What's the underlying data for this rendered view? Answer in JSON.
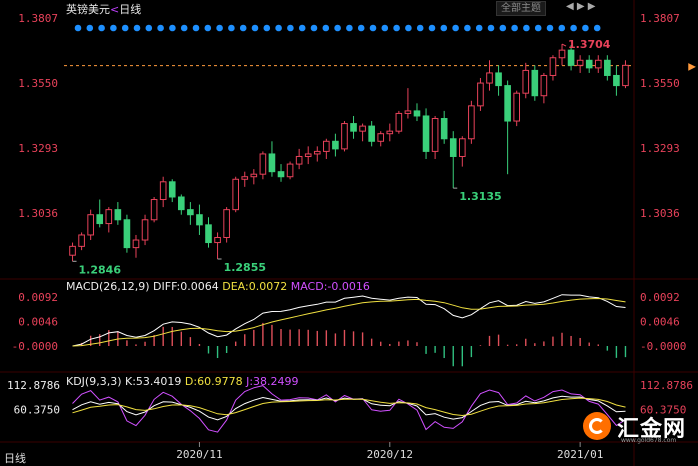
{
  "title": {
    "pair": "英镑美元",
    "sep": "<",
    "period": "日线"
  },
  "toolbar": {
    "theme_label": "全部主题",
    "nav": "◀ ▶ ▶"
  },
  "period_tab": "日线",
  "chart_data": [
    {
      "type": "candlestick",
      "title": "英镑美元 日线",
      "y_ticks": [
        "1.3807",
        "1.3550",
        "1.3293",
        "1.3036"
      ],
      "ylim": [
        1.278,
        1.3807
      ],
      "x_tick_labels": [
        "2020/11",
        "2020/12",
        "2021/01"
      ],
      "current_price_line": 1.3619,
      "annotations": [
        {
          "text": "1.2846",
          "value": 1.2846
        },
        {
          "text": "1.2855",
          "value": 1.2855
        },
        {
          "text": "1.3135",
          "value": 1.3135
        },
        {
          "text": "1.3704",
          "value": 1.3704
        }
      ],
      "series": [
        {
          "name": "price",
          "ohlc": [
            [
              1.287,
              1.292,
              1.2846,
              1.2905
            ],
            [
              1.2905,
              1.296,
              1.289,
              1.295
            ],
            [
              1.295,
              1.305,
              1.293,
              1.303
            ],
            [
              1.303,
              1.309,
              1.298,
              1.2995
            ],
            [
              1.2995,
              1.306,
              1.296,
              1.305
            ],
            [
              1.305,
              1.308,
              1.299,
              1.301
            ],
            [
              1.301,
              1.303,
              1.288,
              1.29
            ],
            [
              1.29,
              1.295,
              1.286,
              1.293
            ],
            [
              1.293,
              1.303,
              1.291,
              1.301
            ],
            [
              1.301,
              1.31,
              1.3,
              1.309
            ],
            [
              1.309,
              1.318,
              1.306,
              1.316
            ],
            [
              1.316,
              1.317,
              1.308,
              1.31
            ],
            [
              1.31,
              1.311,
              1.303,
              1.305
            ],
            [
              1.305,
              1.308,
              1.299,
              1.303
            ],
            [
              1.303,
              1.307,
              1.295,
              1.299
            ],
            [
              1.299,
              1.302,
              1.29,
              1.292
            ],
            [
              1.292,
              1.296,
              1.2855,
              1.294
            ],
            [
              1.294,
              1.306,
              1.292,
              1.305
            ],
            [
              1.305,
              1.318,
              1.304,
              1.317
            ],
            [
              1.317,
              1.32,
              1.314,
              1.318
            ],
            [
              1.318,
              1.321,
              1.315,
              1.319
            ],
            [
              1.319,
              1.328,
              1.317,
              1.327
            ],
            [
              1.327,
              1.332,
              1.318,
              1.32
            ],
            [
              1.32,
              1.323,
              1.316,
              1.318
            ],
            [
              1.318,
              1.324,
              1.317,
              1.323
            ],
            [
              1.323,
              1.329,
              1.321,
              1.326
            ],
            [
              1.326,
              1.33,
              1.323,
              1.327
            ],
            [
              1.327,
              1.33,
              1.324,
              1.328
            ],
            [
              1.328,
              1.333,
              1.325,
              1.332
            ],
            [
              1.332,
              1.335,
              1.326,
              1.329
            ],
            [
              1.329,
              1.34,
              1.328,
              1.339
            ],
            [
              1.339,
              1.342,
              1.333,
              1.336
            ],
            [
              1.336,
              1.339,
              1.332,
              1.338
            ],
            [
              1.338,
              1.34,
              1.33,
              1.332
            ],
            [
              1.332,
              1.336,
              1.33,
              1.335
            ],
            [
              1.335,
              1.339,
              1.332,
              1.336
            ],
            [
              1.336,
              1.344,
              1.335,
              1.343
            ],
            [
              1.343,
              1.353,
              1.341,
              1.344
            ],
            [
              1.344,
              1.347,
              1.34,
              1.342
            ],
            [
              1.342,
              1.345,
              1.325,
              1.328
            ],
            [
              1.328,
              1.342,
              1.325,
              1.341
            ],
            [
              1.341,
              1.344,
              1.331,
              1.333
            ],
            [
              1.333,
              1.336,
              1.3135,
              1.326
            ],
            [
              1.326,
              1.334,
              1.322,
              1.333
            ],
            [
              1.333,
              1.348,
              1.331,
              1.346
            ],
            [
              1.346,
              1.357,
              1.344,
              1.355
            ],
            [
              1.355,
              1.364,
              1.352,
              1.359
            ],
            [
              1.359,
              1.362,
              1.35,
              1.354
            ],
            [
              1.354,
              1.356,
              1.319,
              1.34
            ],
            [
              1.34,
              1.352,
              1.338,
              1.351
            ],
            [
              1.351,
              1.363,
              1.349,
              1.36
            ],
            [
              1.36,
              1.362,
              1.348,
              1.35
            ],
            [
              1.35,
              1.359,
              1.347,
              1.358
            ],
            [
              1.358,
              1.366,
              1.356,
              1.365
            ],
            [
              1.365,
              1.3704,
              1.362,
              1.368
            ],
            [
              1.368,
              1.37,
              1.36,
              1.362
            ],
            [
              1.362,
              1.366,
              1.359,
              1.364
            ],
            [
              1.364,
              1.366,
              1.359,
              1.361
            ],
            [
              1.361,
              1.366,
              1.359,
              1.364
            ],
            [
              1.364,
              1.366,
              1.356,
              1.358
            ],
            [
              1.358,
              1.362,
              1.35,
              1.354
            ],
            [
              1.354,
              1.364,
              1.353,
              1.362
            ]
          ]
        }
      ]
    },
    {
      "type": "macd",
      "legend": {
        "name": "MACD(26,12,9)",
        "diff": "DIFF:0.0064",
        "dea": "DEA:0.0072",
        "macd": "MACD:-0.0016"
      },
      "y_ticks": [
        "0.0092",
        "0.0046",
        "-0.0000"
      ],
      "ylim": [
        -0.0045,
        0.0105
      ],
      "diff_color": "#ffffff",
      "dea_color": "#f0e040",
      "pos_color": "#e0505a",
      "neg_color": "#30c080"
    },
    {
      "type": "kdj",
      "legend": {
        "name": "KDJ(9,3,3)",
        "k": "K:53.4019",
        "d": "D:60.9778",
        "j": "J:38.2499"
      },
      "y_ticks": [
        "112.8786",
        "60.3750"
      ],
      "ylim": [
        -5,
        112.8786
      ],
      "k_color": "#ffffff",
      "d_color": "#f0e040",
      "j_color": "#d050ff"
    }
  ],
  "colors": {
    "up": "#e8425a",
    "down": "#3ad07a",
    "axis_text": "#e8425a",
    "grid": "#1a1a1a",
    "dot": "#1e90ff"
  },
  "logo": {
    "name": "汇金网",
    "url": "www.gold678.com"
  }
}
